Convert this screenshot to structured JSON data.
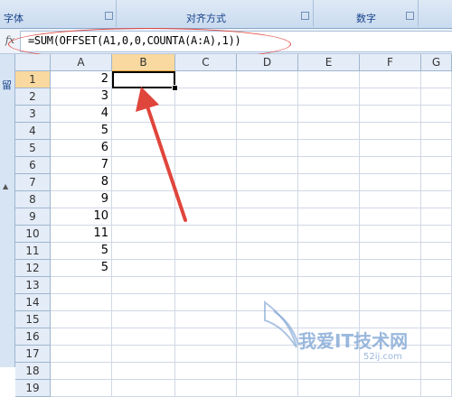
{
  "ribbon": {
    "groups": [
      {
        "label": "字体"
      },
      {
        "label": "对齐方式"
      },
      {
        "label": "数字"
      }
    ]
  },
  "formula_bar": {
    "fx_label": "fx",
    "formula": "=SUM(OFFSET(A1,0,0,COUNTA(A:A),1))"
  },
  "left_pane": {
    "glyph": "留"
  },
  "sheet": {
    "columns": [
      "A",
      "B",
      "C",
      "D",
      "E",
      "F",
      "G"
    ],
    "selected_column": "B",
    "rows": [
      "1",
      "2",
      "3",
      "4",
      "5",
      "6",
      "7",
      "8",
      "9",
      "10",
      "11",
      "12",
      "13",
      "14",
      "15",
      "16",
      "17",
      "18",
      "19"
    ],
    "selected_row": "1",
    "column_a_values": [
      "2",
      "3",
      "4",
      "5",
      "6",
      "7",
      "8",
      "9",
      "10",
      "11",
      "5",
      "5",
      "",
      "",
      "",
      "",
      "",
      "",
      ""
    ]
  },
  "colors": {
    "annotation": "#e0453c",
    "selected_header": "#f9d99f"
  },
  "watermark": {
    "text": "我爱IT技术网",
    "sub": "52ij.com"
  }
}
